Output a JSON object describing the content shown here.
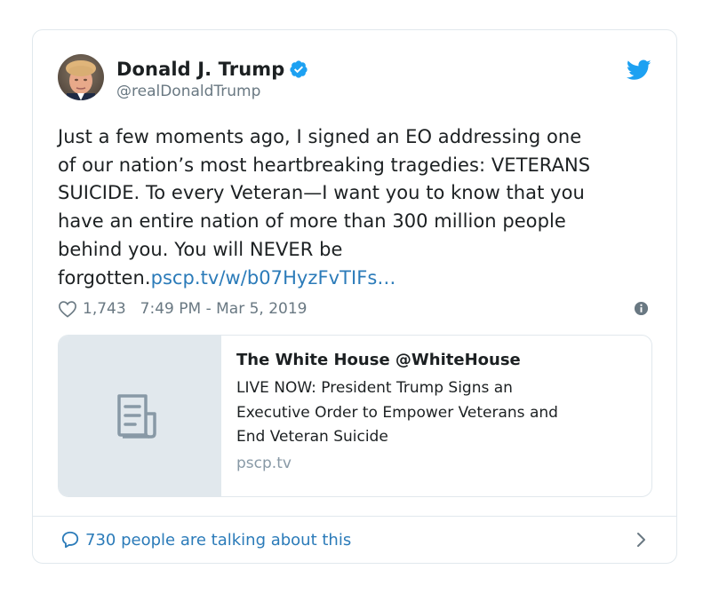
{
  "author": {
    "display_name": "Donald J. Trump",
    "handle": "@realDonaldTrump",
    "verified": true
  },
  "tweet": {
    "text_lines": [
      "Just a few moments ago, I signed an EO addressing one",
      "of our nation’s most heartbreaking tragedies: VETERANS",
      "SUICIDE. To every Veteran—I want you to know that you",
      "have an entire nation of more than 300 million people",
      "behind you. You will NEVER be"
    ],
    "last_line_text": "forgotten.",
    "link_text": "pscp.tv/w/b07HyzFvTIFs…"
  },
  "meta": {
    "likes": "1,743",
    "timestamp": "7:49 PM - Mar 5, 2019"
  },
  "quote": {
    "title": "The White House @WhiteHouse",
    "desc_lines": [
      "LIVE NOW: President Trump Signs an",
      "Executive Order to Empower Veterans and",
      "End Veteran Suicide"
    ],
    "domain": "pscp.tv"
  },
  "footer": {
    "talking_label": "730 people are talking about this"
  },
  "colors": {
    "twitter_blue": "#1da1f2",
    "link_blue": "#2b7bb9",
    "muted_gray": "#697882",
    "border": "#e1e8ed"
  },
  "icons": {
    "bird": "twitter-bird-icon",
    "verified": "verified-badge-icon",
    "heart": "heart-icon",
    "info": "info-icon",
    "doc": "document-icon",
    "bubble": "speech-bubble-icon",
    "chevron": "chevron-right-icon"
  }
}
